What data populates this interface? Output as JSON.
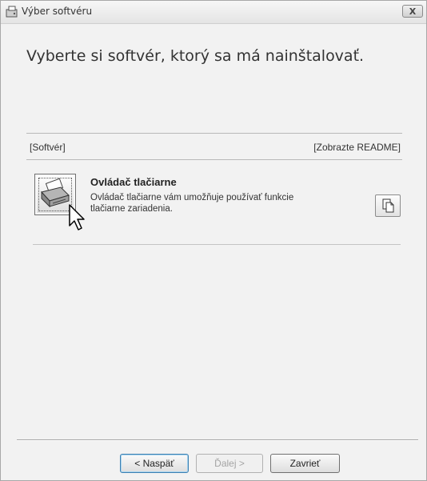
{
  "window": {
    "title": "Výber softvéru",
    "close_label": "X",
    "icon": "installer-icon"
  },
  "heading": "Vyberte si softvér, ktorý sa má nainštalovať.",
  "columns": {
    "software": "[Softvér]",
    "readme": "[Zobrazte README]"
  },
  "software_items": [
    {
      "name": "Ovládač tlačiarne",
      "description": "Ovládač tlačiarne vám umožňuje používať funkcie tlačiarne zariadenia.",
      "icon": "printer-icon",
      "readme_icon": "document-copy-icon"
    }
  ],
  "buttons": {
    "back": "< Naspäť",
    "next": "Ďalej >",
    "close": "Zavrieť"
  }
}
